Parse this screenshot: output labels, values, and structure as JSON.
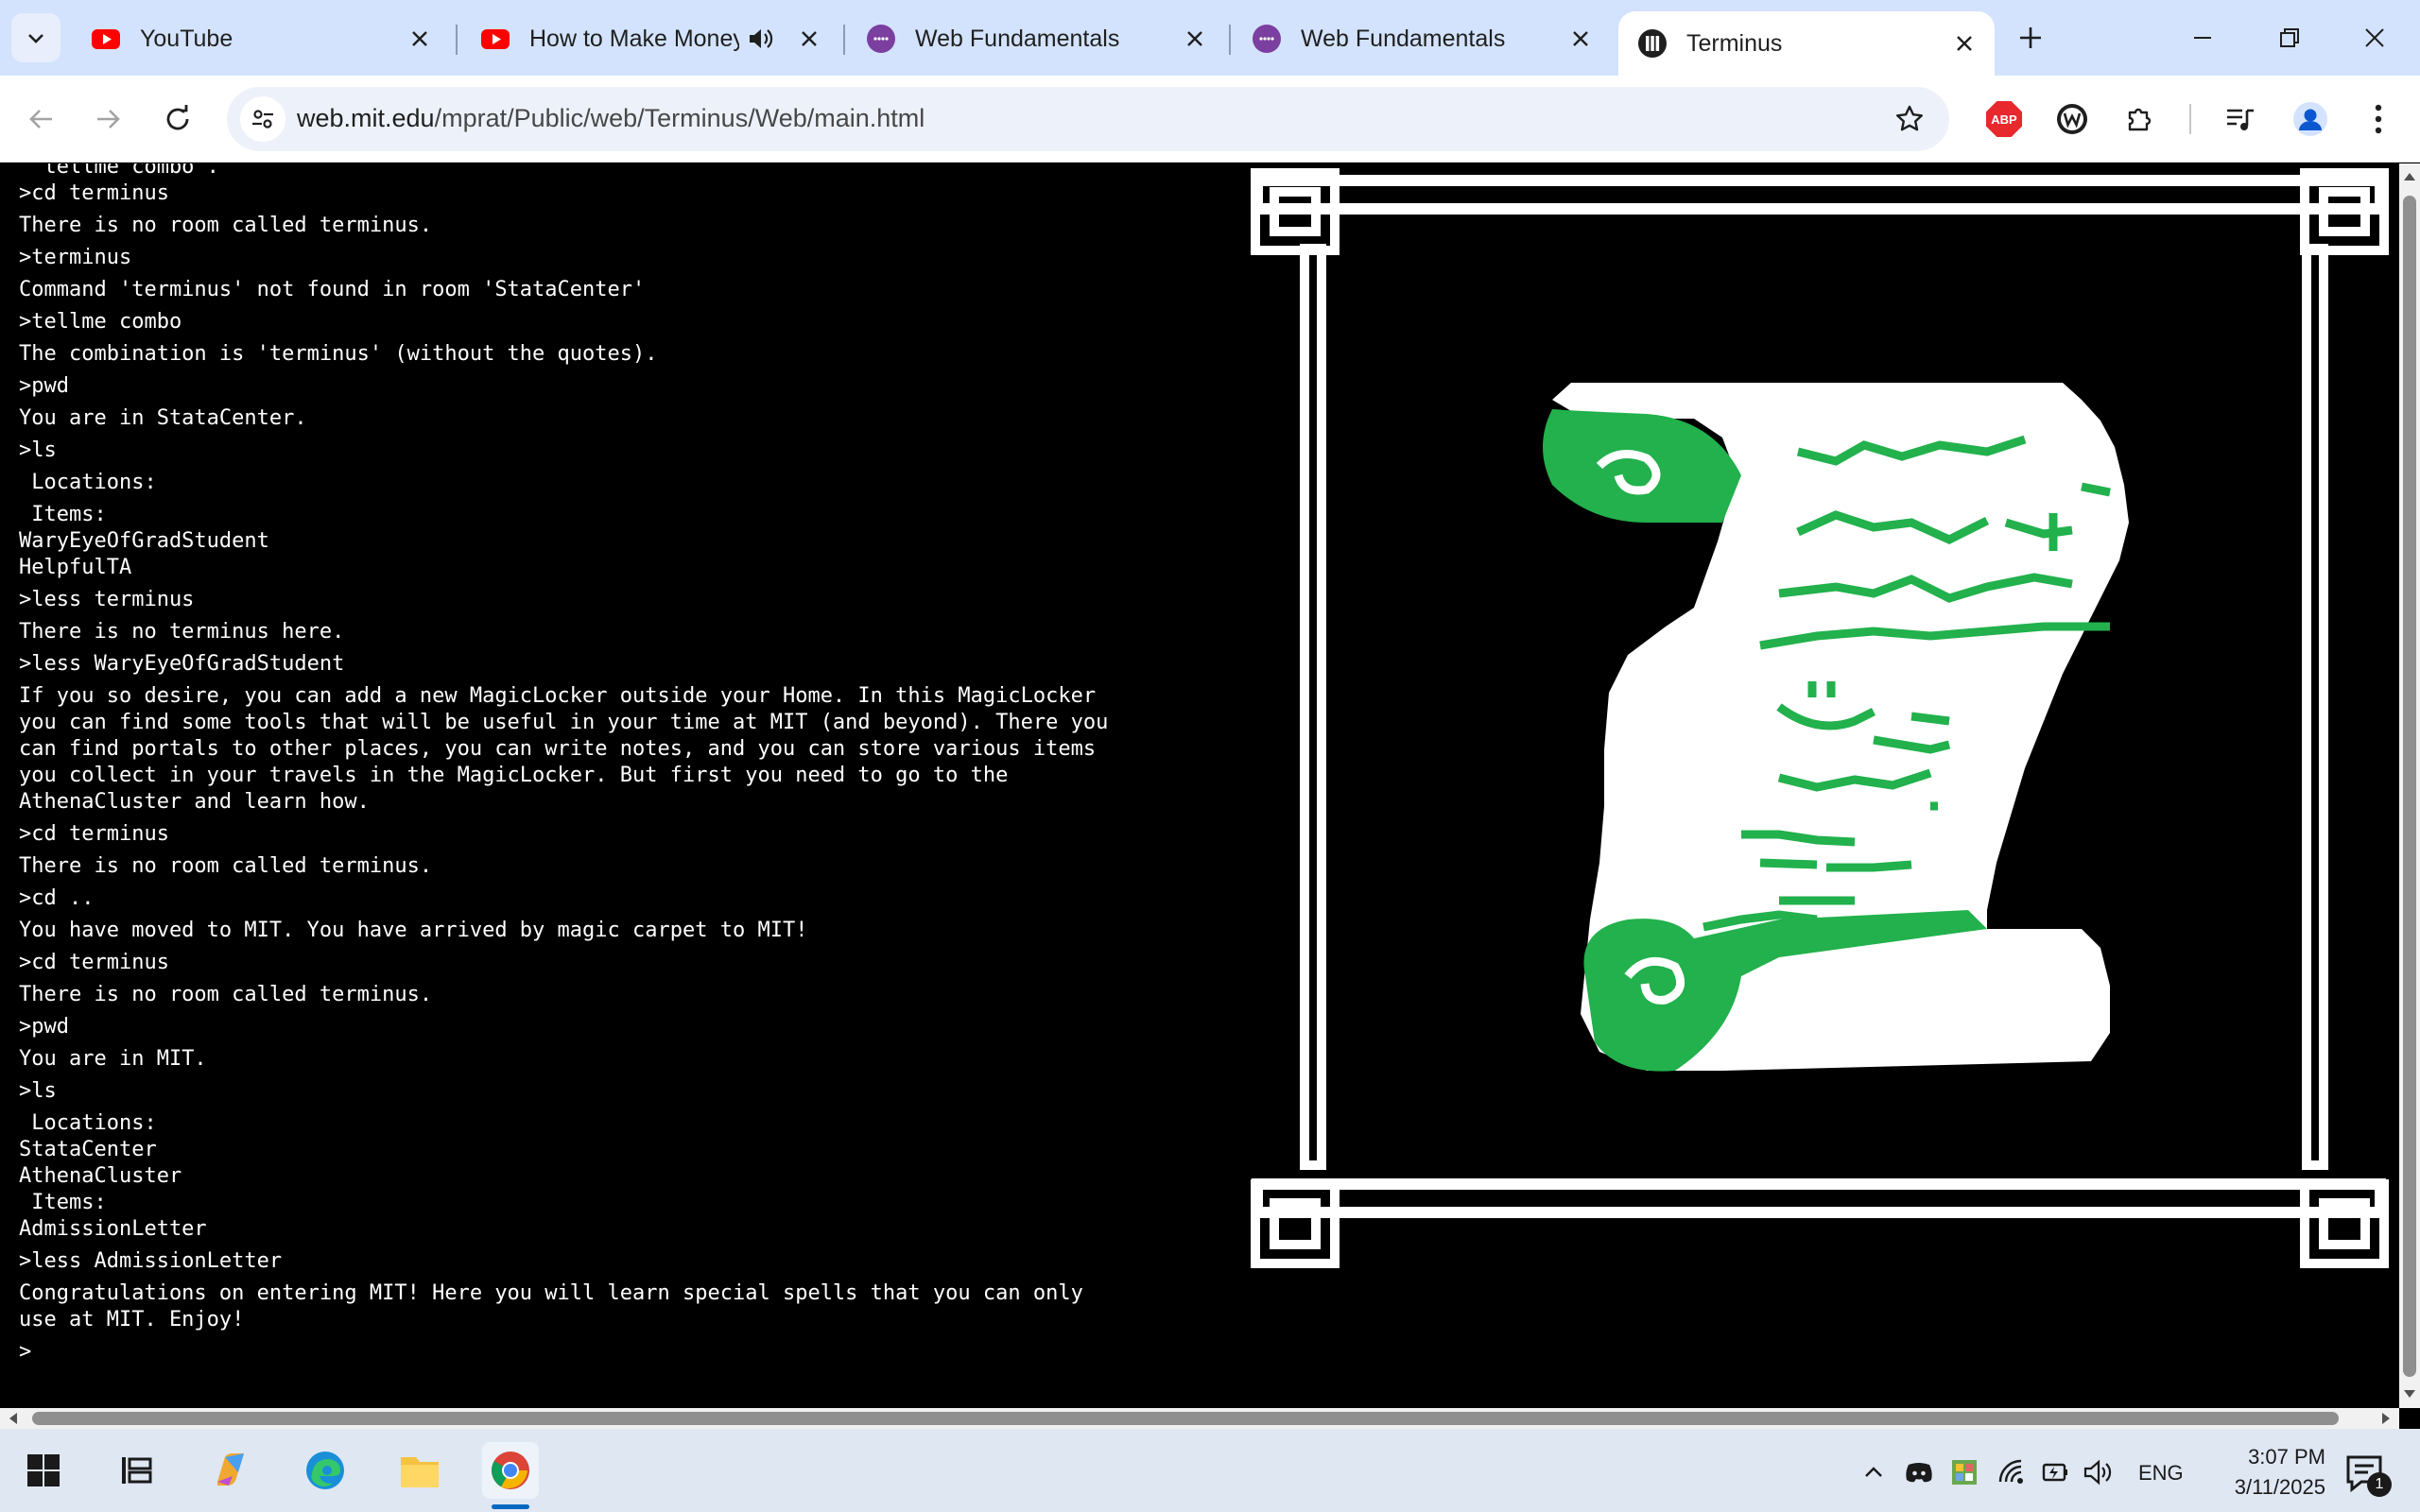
{
  "browser": {
    "tabs": [
      {
        "title": "YouTube",
        "favicon": "youtube-icon"
      },
      {
        "title": "How to Make Money",
        "favicon": "youtube-icon",
        "audio": "speaker-icon"
      },
      {
        "title": "Web Fundamentals - Axs",
        "favicon": "axs-icon"
      },
      {
        "title": "Web Fundamentals - Axs",
        "favicon": "axs-icon"
      },
      {
        "title": "Terminus",
        "favicon": "terminus-icon",
        "active": true
      }
    ],
    "url_host": "web.mit.edu",
    "url_path": "/mprat/Public/web/Terminus/Web/main.html",
    "abp_label": "ABP"
  },
  "terminal": {
    "lines": [
      "  tellme combo .",
      ">cd terminus",
      "There is no room called terminus.",
      ">terminus",
      "Command 'terminus' not found in room 'StataCenter'",
      ">tellme combo",
      "The combination is 'terminus' (without the quotes).",
      ">pwd",
      "You are in StataCenter.",
      ">ls",
      " Locations:",
      "",
      " Items:",
      "WaryEyeOfGradStudent",
      "HelpfulTA",
      ">less terminus",
      "There is no terminus here.",
      ">less WaryEyeOfGradStudent",
      "If you so desire, you can add a new MagicLocker outside your Home. In this MagicLocker",
      "you can find some tools that will be useful in your time at MIT (and beyond). There you",
      "can find portals to other places, you can write notes, and you can store various items",
      "you collect in your travels in the MagicLocker. But first you need to go to the",
      "AthenaCluster and learn how.",
      ">cd terminus",
      "There is no room called terminus.",
      ">cd ..",
      "You have moved to MIT. You have arrived by magic carpet to MIT!",
      ">cd terminus",
      "There is no room called terminus.",
      ">pwd",
      "You are in MIT.",
      ">ls",
      " Locations:",
      "StataCenter",
      "AthenaCluster",
      " Items:",
      "AdmissionLetter",
      ">less AdmissionLetter",
      "Congratulations on entering MIT! Here you will learn special spells that you can only",
      "use at MIT. Enjoy!",
      ">"
    ]
  },
  "art": {
    "subject": "scroll-icon",
    "frame_color": "#ffffff",
    "scroll_green": "#22b14c"
  },
  "taskbar": {
    "language": "ENG",
    "time": "3:07 PM",
    "date": "3/11/2025",
    "notification_count": "1"
  }
}
